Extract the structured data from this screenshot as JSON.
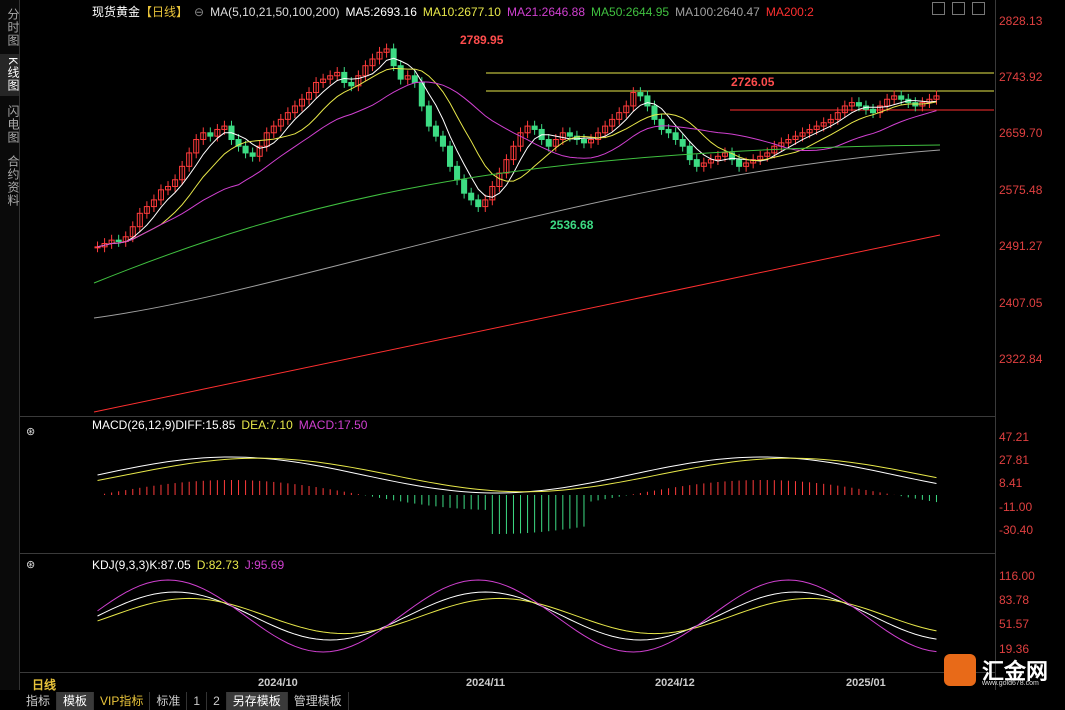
{
  "sidebar": {
    "tabs": [
      "分时图",
      "K线图",
      "闪电图",
      "合约资料"
    ]
  },
  "main": {
    "symbol": "现货黄金",
    "period": "【日线】",
    "ma_params": "MA(5,10,21,50,100,200)",
    "ma": [
      {
        "label": "MA5:2693.16",
        "color": "#ffffff"
      },
      {
        "label": "MA10:2677.10",
        "color": "#e8e84a"
      },
      {
        "label": "MA21:2646.88",
        "color": "#d040d0"
      },
      {
        "label": "MA50:2644.95",
        "color": "#40c040"
      },
      {
        "label": "MA100:2640.47",
        "color": "#a0a0a0"
      },
      {
        "label": "MA200:2",
        "color": "#ff3030"
      }
    ],
    "yticks": [
      "2828.13",
      "2743.92",
      "2659.70",
      "2575.48",
      "2491.27",
      "2407.05",
      "2322.84"
    ],
    "annotations": {
      "high": "2789.95",
      "low": "2536.68",
      "mid": "2726.05"
    }
  },
  "macd": {
    "title": "MACD(26,12,9)",
    "diff": "DIFF:15.85",
    "dea": "DEA:7.10",
    "macd": "MACD:17.50",
    "yticks": [
      "47.21",
      "27.81",
      "8.41",
      "-11.00",
      "-30.40"
    ]
  },
  "kdj": {
    "title": "KDJ(9,3,3)",
    "k": "K:87.05",
    "d": "D:82.73",
    "j": "J:95.69",
    "yticks": [
      "116.00",
      "83.78",
      "51.57",
      "19.36"
    ]
  },
  "xaxis": [
    "2024/10",
    "2024/11",
    "2024/12",
    "2025/01"
  ],
  "bottom": {
    "period_label": "日线",
    "tabs": [
      "指标",
      "模板",
      "VIP指标",
      "标准",
      "1",
      "2",
      "另存模板",
      "管理模板"
    ],
    "selected": [
      1,
      6
    ]
  },
  "logo": {
    "name": "汇金网",
    "url": "www.gold678.com"
  },
  "colors": {
    "up": "#ff3b3b",
    "down": "#3ddc84"
  }
}
